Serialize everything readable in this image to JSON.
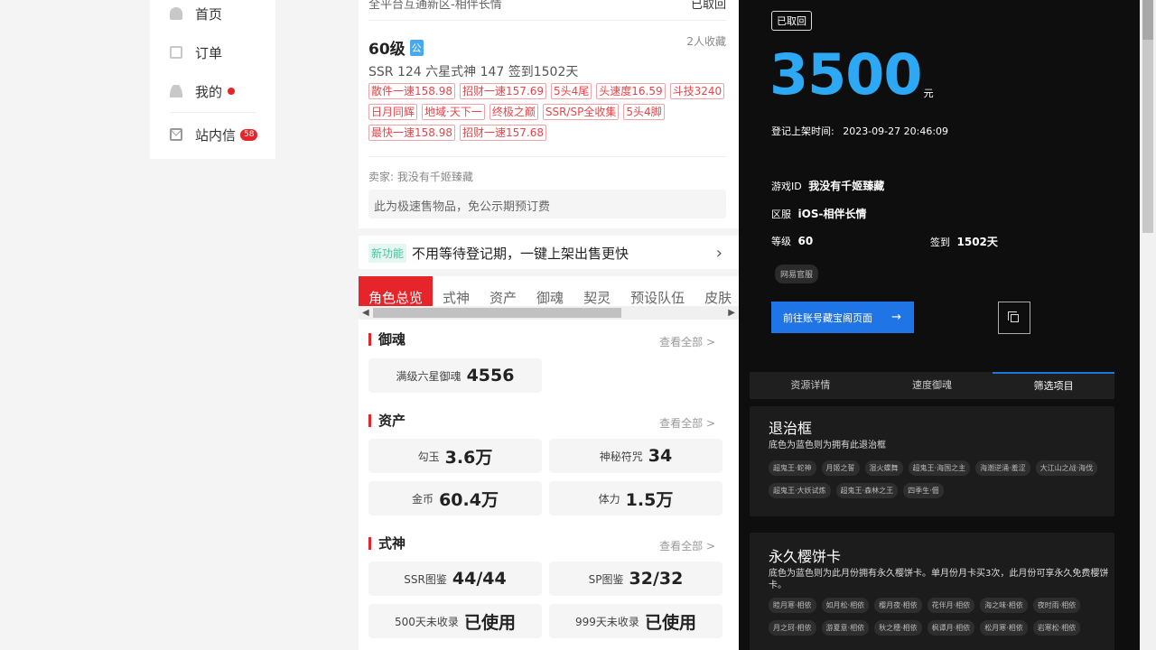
{
  "nav": {
    "home": "首页",
    "orders": "订单",
    "me": "我的",
    "inbox": "站内信",
    "inbox_badge": "58"
  },
  "listing": {
    "top_text": "全平台互通新区-相伴长情",
    "top_status": "已取回",
    "level": "60级",
    "public_tag": "公",
    "favorites": "2人收藏",
    "stats": "SSR 124   六星式神 147   签到1502天",
    "tags": [
      "散件一速158.98",
      "招财一速157.69",
      "5头4尾",
      "头速度16.59",
      "斗技3240",
      "日月同辉",
      "地域·天下一",
      "终极之巅",
      "SSR/SP全收集",
      "5头4脚",
      "最快一速158.98",
      "招财一速157.68"
    ],
    "seller": "卖家: 我没有千姬臻藏",
    "notice": "此为极速售物品，免公示期预订费",
    "new_feature_tag": "新功能",
    "new_feature_text": "不用等待登记期，一键上架出售更快"
  },
  "tabs": [
    "角色总览",
    "式神",
    "资产",
    "御魂",
    "契灵",
    "预设队伍",
    "皮肤"
  ],
  "sections": {
    "yuhun": {
      "title": "御魂",
      "view_all": "查看全部 >",
      "cards": [
        {
          "label": "满级六星御魂",
          "value": "4556"
        }
      ]
    },
    "assets": {
      "title": "资产",
      "view_all": "查看全部 >",
      "cards": [
        {
          "label": "勾玉",
          "value": "3.6万"
        },
        {
          "label": "神秘符咒",
          "value": "34"
        },
        {
          "label": "金币",
          "value": "60.4万"
        },
        {
          "label": "体力",
          "value": "1.5万"
        }
      ]
    },
    "shishen": {
      "title": "式神",
      "view_all": "查看全部 >",
      "cards": [
        {
          "label": "SSR图鉴",
          "value": "44/44"
        },
        {
          "label": "SP图鉴",
          "value": "32/32"
        },
        {
          "label": "500天未收录",
          "value": "已使用"
        },
        {
          "label": "999天未收录",
          "value": "已使用"
        }
      ]
    }
  },
  "detail": {
    "status": "已取回",
    "price": "3500",
    "currency": "元",
    "listed_label": "登记上架时间:",
    "listed_time": "2023-09-27 20:46:09",
    "game_id_label": "游戏ID",
    "game_id": "我没有千姬臻藏",
    "server_label": "区服",
    "server": "iOS-相伴长情",
    "level_label": "等级",
    "level": "60",
    "signin_label": "签到",
    "signin": "1502天",
    "official_tag": "网易官服",
    "go_button": "前往账号藏宝阁页面",
    "tabs": [
      "资源详情",
      "速度御魂",
      "筛选项目"
    ],
    "block1": {
      "title": "退治框",
      "desc": "底色为蓝色则为拥有此退治框",
      "chips": [
        "超鬼王·蛇神",
        "月姬之誓",
        "湿火蝶舞",
        "超鬼王·海国之主",
        "海潮逆涌·羞涩",
        "大江山之战·海伐",
        "超鬼王·大妖试炼",
        "超鬼王·森林之王",
        "四季生·佃"
      ]
    },
    "block2": {
      "title": "永久樱饼卡",
      "desc": "底色为蓝色则为此月份拥有永久樱饼卡。单月份月卡买3次，此月份可享永久免费樱饼卡。",
      "chips": [
        "睦月寒·相依",
        "如月松·相依",
        "樱月夜·相依",
        "花伴月·相依",
        "海之味·相依",
        "夜时雨·相依",
        "月之珂·相依",
        "游夏意·相依",
        "秋之穗·相依",
        "枫谭月·相依",
        "松月寒·相依",
        "岩寒松·相依"
      ]
    }
  }
}
